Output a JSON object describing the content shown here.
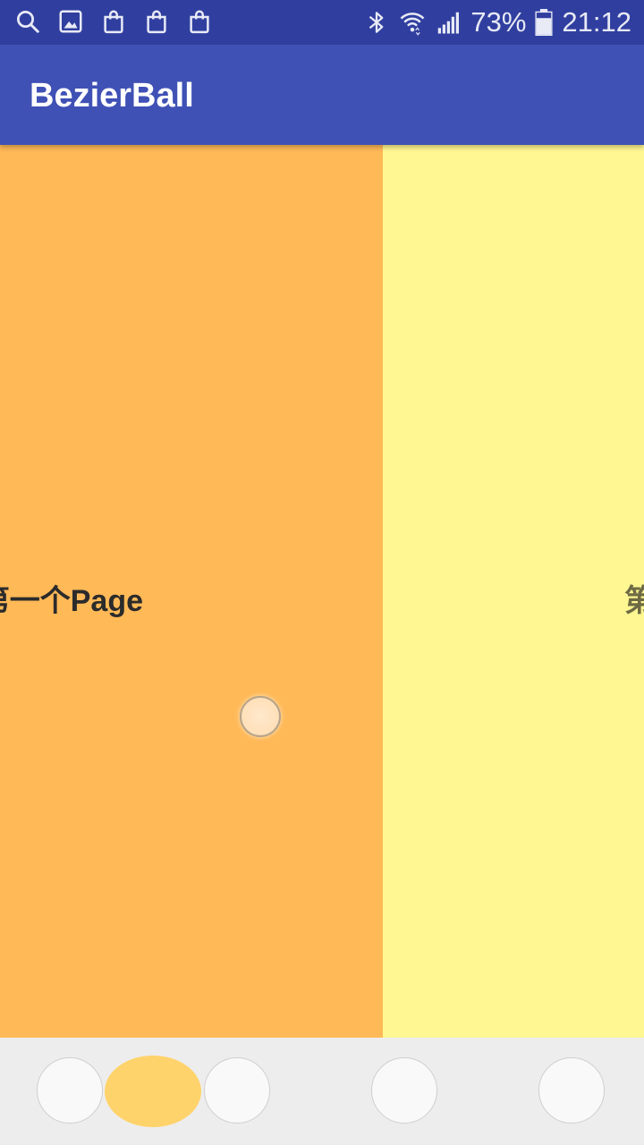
{
  "status_bar": {
    "left_icons": [
      "search-icon",
      "gallery-icon",
      "shopping-bag-icon",
      "shopping-bag-icon",
      "shopping-bag-icon"
    ],
    "right_icons": [
      "bluetooth-icon",
      "wifi-icon",
      "signal-icon",
      "battery-icon"
    ],
    "battery_percent": "73%",
    "time": "21:12"
  },
  "toolbar": {
    "title": "BezierBall"
  },
  "pages": [
    {
      "text": "第一个Page",
      "color": "#ffb957"
    },
    {
      "text": "第",
      "color": "#fff791"
    }
  ],
  "indicator": {
    "dot_count": 4,
    "current_index": 0,
    "accent_color": "#ffd36b"
  }
}
